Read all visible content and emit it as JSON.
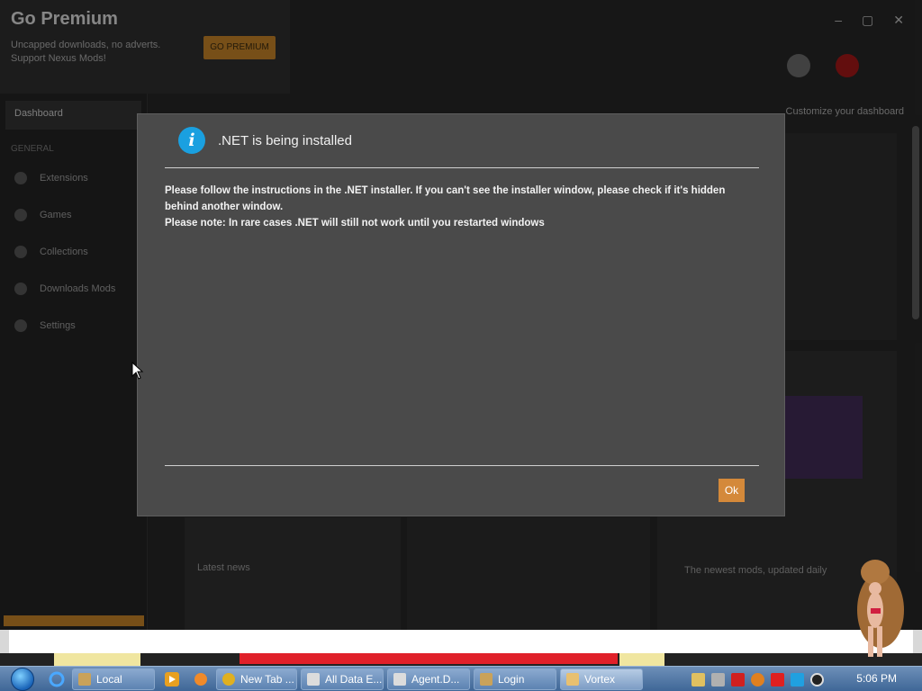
{
  "background_app": {
    "banner": {
      "title": "Go Premium",
      "subtitle": "Uncapped downloads, no adverts. Support Nexus Mods!",
      "button_label": "GO PREMIUM"
    },
    "sidebar": {
      "active_item": "Dashboard",
      "section_title": "GENERAL",
      "items": [
        "Extensions",
        "Games",
        "Collections",
        "Downloads Mods",
        "Settings"
      ]
    },
    "top_right_link": "Customize your dashboard",
    "panel_b_title": "Latest news",
    "panel_d_text": "The newest mods, updated daily"
  },
  "dialog": {
    "title": ".NET is being installed",
    "body_line1": "Please follow the instructions in the .NET installer. If you can't see the installer window, please check if it's hidden behind another window.",
    "body_line2": "Please note: In rare cases .NET will still not work until you restarted windows",
    "ok_label": "Ok"
  },
  "taskbar": {
    "buttons": [
      {
        "label": "Local",
        "icon": "folder-icon",
        "color": "#c9a25a"
      },
      {
        "label": "New Tab ...",
        "icon": "chrome-icon",
        "color": "#e0b020"
      },
      {
        "label": "All Data E...",
        "icon": "window-icon",
        "color": "#dcdcdc"
      },
      {
        "label": "Agent.D...",
        "icon": "window-icon",
        "color": "#dcdcdc"
      },
      {
        "label": "Login",
        "icon": "lock-icon",
        "color": "#c9a25a"
      },
      {
        "label": "Vortex",
        "icon": "vortex-icon",
        "color": "#e8c070"
      }
    ],
    "clock": "5:06 PM"
  },
  "colors": {
    "accent": "#d4893a",
    "info": "#1aa0e0",
    "dialog_bg": "#4a4a4a"
  }
}
